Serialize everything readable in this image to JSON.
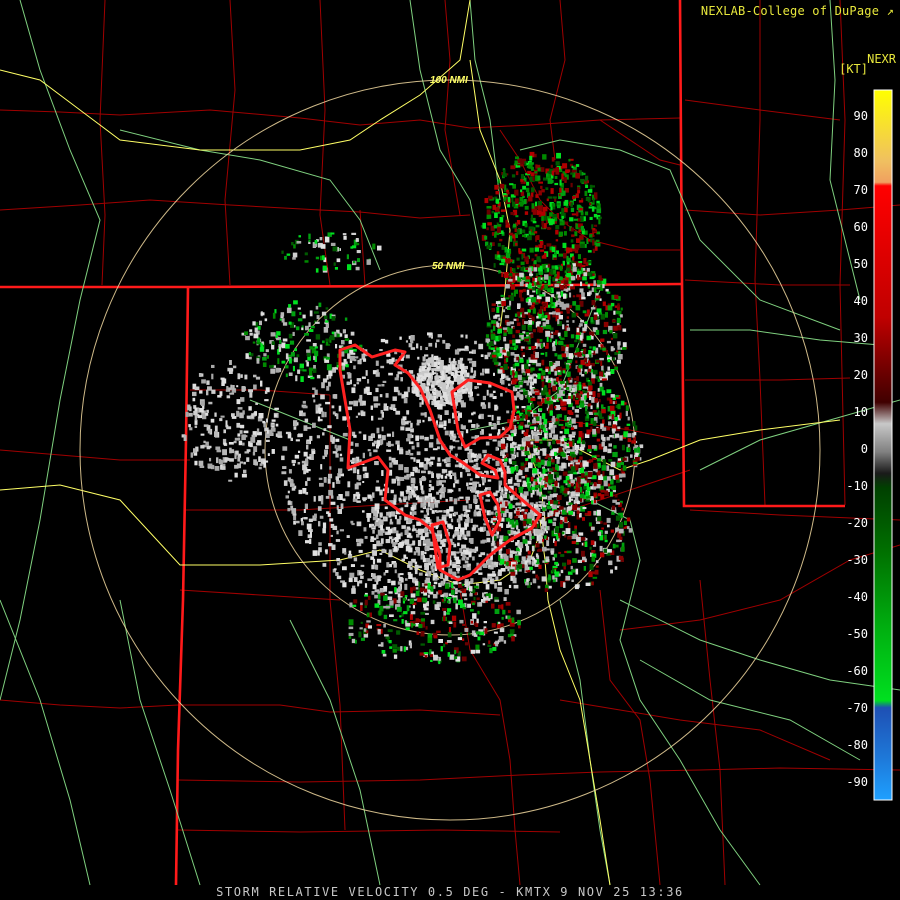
{
  "header": {
    "credit": "NEXLAB-College of DuPage",
    "credit_icon": "external-link-icon",
    "product": "NEXR",
    "unit": "[KT]"
  },
  "range_rings": {
    "outer_label": "100 NMI",
    "inner_label": "50 NMI"
  },
  "footer": {
    "caption": "STORM RELATIVE VELOCITY 0.5 DEG - KMTX 9 NOV 25 13:36"
  },
  "color_scale": {
    "labels": [
      "90",
      "80",
      "70",
      "60",
      "50",
      "40",
      "30",
      "20",
      "10",
      "0",
      "-10",
      "-20",
      "-30",
      "-40",
      "-50",
      "-60",
      "-70",
      "-80",
      "-90"
    ],
    "colors": {
      "high_yellow": "#ffff00",
      "orange": "#f0a060",
      "red": "#ff0000",
      "dark_red": "#6a0000",
      "gray": "#c0c0c0",
      "dark_green": "#005a00",
      "green": "#00e020",
      "dark_blue": "#1e50b4",
      "light_blue": "#1ea0ff"
    }
  },
  "map_colors": {
    "state_border": "#ff1a1a",
    "county_line": "#a00000",
    "highway": "#ffff66",
    "road": "#7fd07f",
    "range_ring": "#f2d9a0",
    "warning_polygon": "#ff2020"
  }
}
